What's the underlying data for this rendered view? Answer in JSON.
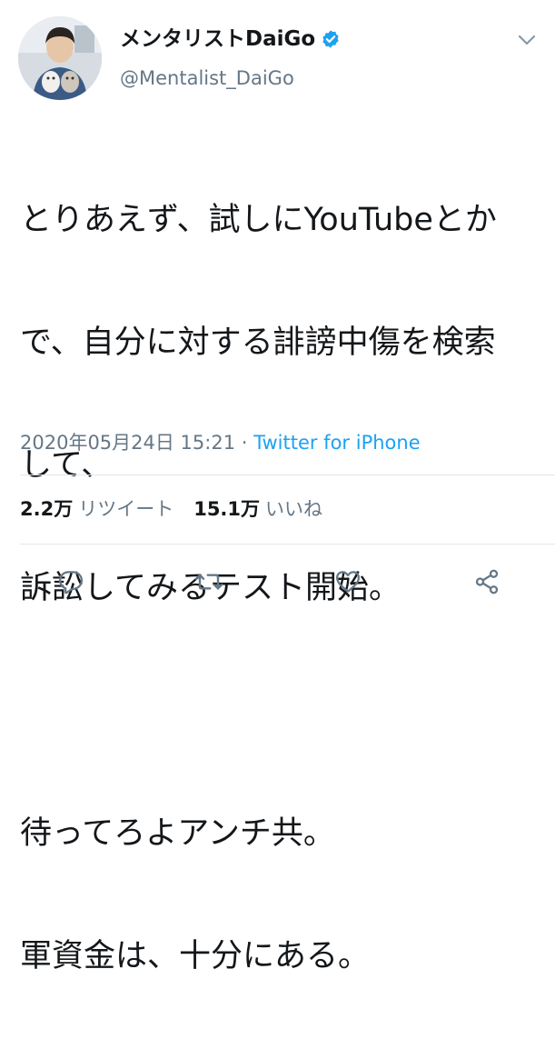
{
  "author": {
    "display_name": "メンタリストDaiGo",
    "handle": "@Mentalist_DaiGo",
    "avatar_icon": "profile-photo-with-cats",
    "verified_icon": "verified-badge-icon"
  },
  "tweet": {
    "lines": [
      "とりあえず、試しにYouTubeとか",
      "で、自分に対する誹謗中傷を検索",
      "して、",
      "訴訟してみるテスト開始。",
      "",
      "待ってろよアンチ共。",
      "軍資金は、十分にある。"
    ],
    "timestamp": "2020年05月24日 15:21",
    "separator": " · ",
    "source": "Twitter for iPhone"
  },
  "stats": {
    "retweets_count": "2.2万",
    "retweets_label": "リツイート",
    "likes_count": "15.1万",
    "likes_label": "いいね"
  },
  "actions": {
    "reply_icon": "reply-icon",
    "retweet_icon": "retweet-icon",
    "like_icon": "heart-icon",
    "share_icon": "share-icon"
  },
  "colors": {
    "text": "#14171a",
    "secondary": "#657786",
    "accent": "#1da1f2",
    "divider": "#e1e8ed"
  }
}
